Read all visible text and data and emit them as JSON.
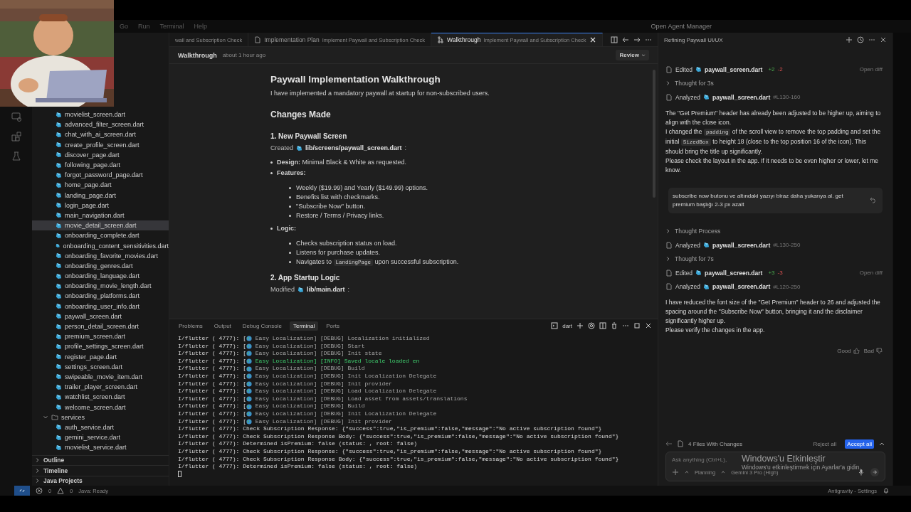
{
  "menu": {
    "items": [
      "Go",
      "Run",
      "Terminal",
      "Help"
    ],
    "agent_manager": "Open Agent Manager"
  },
  "sidebar": {
    "items": [
      {
        "label": "movielist_screen.dart",
        "selected": false
      },
      {
        "label": "advanced_filter_screen.dart",
        "selected": false
      },
      {
        "label": "chat_with_ai_screen.dart",
        "selected": false
      },
      {
        "label": "create_profile_screen.dart",
        "selected": false
      },
      {
        "label": "discover_page.dart",
        "selected": false
      },
      {
        "label": "following_page.dart",
        "selected": false
      },
      {
        "label": "forgot_password_page.dart",
        "selected": false
      },
      {
        "label": "home_page.dart",
        "selected": false
      },
      {
        "label": "landing_page.dart",
        "selected": false
      },
      {
        "label": "login_page.dart",
        "selected": false
      },
      {
        "label": "main_navigation.dart",
        "selected": false
      },
      {
        "label": "movie_detail_screen.dart",
        "selected": true
      },
      {
        "label": "onboarding_complete.dart",
        "selected": false
      },
      {
        "label": "onboarding_content_sensitivities.dart",
        "selected": false
      },
      {
        "label": "onboarding_favorite_movies.dart",
        "selected": false
      },
      {
        "label": "onboarding_genres.dart",
        "selected": false
      },
      {
        "label": "onboarding_language.dart",
        "selected": false
      },
      {
        "label": "onboarding_movie_length.dart",
        "selected": false
      },
      {
        "label": "onboarding_platforms.dart",
        "selected": false
      },
      {
        "label": "onboarding_user_info.dart",
        "selected": false
      },
      {
        "label": "paywall_screen.dart",
        "selected": false
      },
      {
        "label": "person_detail_screen.dart",
        "selected": false
      },
      {
        "label": "premium_screen.dart",
        "selected": false
      },
      {
        "label": "profile_settings_screen.dart",
        "selected": false
      },
      {
        "label": "register_page.dart",
        "selected": false
      },
      {
        "label": "settings_screen.dart",
        "selected": false
      },
      {
        "label": "swipeable_movie_item.dart",
        "selected": false
      },
      {
        "label": "trailer_player_screen.dart",
        "selected": false
      },
      {
        "label": "watchlist_screen.dart",
        "selected": false
      },
      {
        "label": "welcome_screen.dart",
        "selected": false
      },
      {
        "label": "services",
        "kind": "folder",
        "expanded": true,
        "selected": false,
        "children": [
          {
            "label": "auth_service.dart",
            "selected": false
          },
          {
            "label": "gemini_service.dart",
            "selected": false
          },
          {
            "label": "movielist_service.dart",
            "selected": false
          }
        ]
      }
    ],
    "sections": [
      {
        "label": "Outline",
        "expanded": false
      },
      {
        "label": "Timeline",
        "expanded": false
      },
      {
        "label": "Java Projects",
        "expanded": false
      }
    ]
  },
  "editor": {
    "tabs": [
      {
        "kind": "partial",
        "subtitle": "wall and Subscription Check",
        "selected": false
      },
      {
        "kind": "document",
        "title": "Implementation Plan",
        "subtitle": "Implement Paywall and Subscription Check",
        "selected": false
      },
      {
        "kind": "walkthrough",
        "title": "Walkthrough",
        "subtitle": "Implement Paywall and Subscription Check",
        "selected": true
      }
    ],
    "breadcrumb": {
      "title": "Walkthrough",
      "time": "about 1 hour ago",
      "review": "Review"
    },
    "blocks": [
      {
        "kind": "h1",
        "text": "Paywall Implementation Walkthrough"
      },
      {
        "kind": "p",
        "text": "I have implemented a mandatory paywall at startup for non-subscribed users."
      },
      {
        "kind": "h2",
        "text": "Changes Made"
      },
      {
        "kind": "h3",
        "text": "1. New Paywall Screen"
      },
      {
        "kind": "file",
        "label": "Created",
        "file": "lib/screens/paywall_screen.dart",
        "suffix": ":"
      },
      {
        "kind": "bullet",
        "label": "Design:",
        "text": "Minimal Black & White as requested."
      },
      {
        "kind": "bullet",
        "label": "Features:",
        "children": [
          [
            {
              "kind": "text",
              "text": "Weekly ($19.99) and Yearly ($149.99) options."
            }
          ],
          [
            {
              "kind": "text",
              "text": "Benefits list with checkmarks."
            }
          ],
          [
            {
              "kind": "text",
              "text": "\"Subscribe Now\" button."
            }
          ],
          [
            {
              "kind": "text",
              "text": "Restore / Terms / Privacy links."
            }
          ]
        ]
      },
      {
        "kind": "bullet",
        "label": "Logic:",
        "children": [
          [
            {
              "kind": "text",
              "text": "Checks subscription status on load."
            }
          ],
          [
            {
              "kind": "text",
              "text": "Listens for purchase updates."
            }
          ],
          [
            {
              "kind": "text",
              "text": "Navigates to"
            },
            {
              "kind": "code",
              "text": "LandingPage"
            },
            {
              "kind": "text",
              "text": "upon successful subscription."
            }
          ]
        ]
      },
      {
        "kind": "h3",
        "text": "2. App Startup Logic"
      },
      {
        "kind": "file",
        "label": "Modified",
        "file": "lib/main.dart",
        "suffix": ":"
      }
    ]
  },
  "panel": {
    "tabs": [
      {
        "label": "Problems",
        "selected": false
      },
      {
        "label": "Output",
        "selected": false
      },
      {
        "label": "Debug Console",
        "selected": false
      },
      {
        "label": "Terminal",
        "selected": true
      },
      {
        "label": "Ports",
        "selected": false
      }
    ],
    "shell": "dart",
    "lines": [
      {
        "kind": "localization",
        "prefix": "I/flutter ( 4777): [",
        "text": "Easy Localization] [DEBUG] Localization initialized",
        "highlight": false
      },
      {
        "kind": "localization",
        "prefix": "I/flutter ( 4777): [",
        "text": "Easy Localization] [DEBUG] Start",
        "highlight": false
      },
      {
        "kind": "localization",
        "prefix": "I/flutter ( 4777): [",
        "text": "Easy Localization] [DEBUG] Init state",
        "highlight": false
      },
      {
        "kind": "localization",
        "prefix": "I/flutter ( 4777): [",
        "text": "Easy Localization] [INFO] Saved locale loaded en",
        "highlight": true
      },
      {
        "kind": "localization",
        "prefix": "I/flutter ( 4777): [",
        "text": "Easy Localization] [DEBUG] Build",
        "highlight": false
      },
      {
        "kind": "localization",
        "prefix": "I/flutter ( 4777): [",
        "text": "Easy Localization] [DEBUG] Init Localization Delegate",
        "highlight": false
      },
      {
        "kind": "localization",
        "prefix": "I/flutter ( 4777): [",
        "text": "Easy Localization] [DEBUG] Init provider",
        "highlight": false
      },
      {
        "kind": "localization",
        "prefix": "I/flutter ( 4777): [",
        "text": "Easy Localization] [DEBUG] Load Localization Delegate",
        "highlight": false
      },
      {
        "kind": "localization",
        "prefix": "I/flutter ( 4777): [",
        "text": "Easy Localization] [DEBUG] Load asset from assets/translations",
        "highlight": false
      },
      {
        "kind": "localization",
        "prefix": "I/flutter ( 4777): [",
        "text": "Easy Localization] [DEBUG] Build",
        "highlight": false
      },
      {
        "kind": "localization",
        "prefix": "I/flutter ( 4777): [",
        "text": "Easy Localization] [DEBUG] Init Localization Delegate",
        "highlight": false
      },
      {
        "kind": "localization",
        "prefix": "I/flutter ( 4777): [",
        "text": "Easy Localization] [DEBUG] Init provider",
        "highlight": false
      },
      {
        "kind": "plain",
        "text": "I/flutter ( 4777): Check Subscription Response: {\"success\":true,\"is_premium\":false,\"message\":\"No active subscription found\"}"
      },
      {
        "kind": "plain",
        "text": "I/flutter ( 4777): Check Subscription Response Body: {\"success\":true,\"is_premium\":false,\"message\":\"No active subscription found\"}"
      },
      {
        "kind": "plain",
        "text": "I/flutter ( 4777): Determined isPremium: false (status: , root: false)"
      },
      {
        "kind": "plain",
        "text": "I/flutter ( 4777): Check Subscription Response: {\"success\":true,\"is_premium\":false,\"message\":\"No active subscription found\"}"
      },
      {
        "kind": "plain",
        "text": "I/flutter ( 4777): Check Subscription Response Body: {\"success\":true,\"is_premium\":false,\"message\":\"No active subscription found\"}"
      },
      {
        "kind": "plain",
        "text": "I/flutter ( 4777): Determined isPremium: false (status: , root: false)"
      }
    ]
  },
  "chat": {
    "title": "Refining Paywall UI/UX",
    "items": [
      {
        "kind": "edited",
        "action": "Edited",
        "file": "paywall_screen.dart",
        "added": "+2",
        "removed": "-2",
        "link": "Open diff"
      },
      {
        "kind": "thought",
        "text": "Thought for 3s"
      },
      {
        "kind": "analyzed",
        "action": "Analyzed",
        "file": "paywall_screen.dart",
        "range": "#L130-160"
      },
      {
        "kind": "message",
        "paragraphs": [
          [
            {
              "kind": "text",
              "text": "The \"Get Premium\" header has already been adjusted to be higher up, aiming to align with the close icon."
            }
          ],
          [
            {
              "kind": "text",
              "text": "I changed the"
            },
            {
              "kind": "code",
              "text": "padding"
            },
            {
              "kind": "text",
              "text": "of the scroll view to remove the top padding and set the initial"
            },
            {
              "kind": "code",
              "text": "SizedBox"
            },
            {
              "kind": "text",
              "text": "to height 18 (close to the top position 16 of the icon). This should bring the title up significantly."
            }
          ],
          [
            {
              "kind": "text",
              "text": "Please check the layout in the app. If it needs to be even higher or lower, let me know."
            }
          ]
        ]
      },
      {
        "kind": "user",
        "text": "subscribe now butonu ve altındaki yazıyı biraz daha yukarıya al. get premium başlığı 2-3 px azalt"
      },
      {
        "kind": "thought",
        "text": "Thought Process"
      },
      {
        "kind": "analyzed",
        "action": "Analyzed",
        "file": "paywall_screen.dart",
        "range": "#L130-250"
      },
      {
        "kind": "thought",
        "text": "Thought for 7s"
      },
      {
        "kind": "edited",
        "action": "Edited",
        "file": "paywall_screen.dart",
        "added": "+3",
        "removed": "-3",
        "link": "Open diff"
      },
      {
        "kind": "analyzed",
        "action": "Analyzed",
        "file": "paywall_screen.dart",
        "range": "#L120-250"
      },
      {
        "kind": "message",
        "paragraphs": [
          [
            {
              "kind": "text",
              "text": "I have reduced the font size of the \"Get Premium\" header to 26 and adjusted the spacing around the \"Subscribe Now\" button, bringing it and the disclaimer significantly higher up."
            }
          ],
          [
            {
              "kind": "text",
              "text": "Please verify the changes in the app."
            }
          ]
        ]
      },
      {
        "kind": "feedback",
        "good": "Good",
        "bad": "Bad"
      }
    ],
    "changes": {
      "text": "4 Files With Changes",
      "reject": "Reject all",
      "accept": "Accept all"
    },
    "input": {
      "placeholder": "Ask anything (Ctrl+L),",
      "mode": "Planning",
      "model": "Gemini 3 Pro (High)"
    }
  },
  "windows_notice": {
    "title": "Windows'u Etkinleştir",
    "text": "Windows'u etkinleştirmek için Ayarlar'a gidin."
  },
  "status_bar": {
    "errors": "0",
    "warnings": "0",
    "java": "Java: Ready",
    "right": "Antigravity - Settings"
  }
}
